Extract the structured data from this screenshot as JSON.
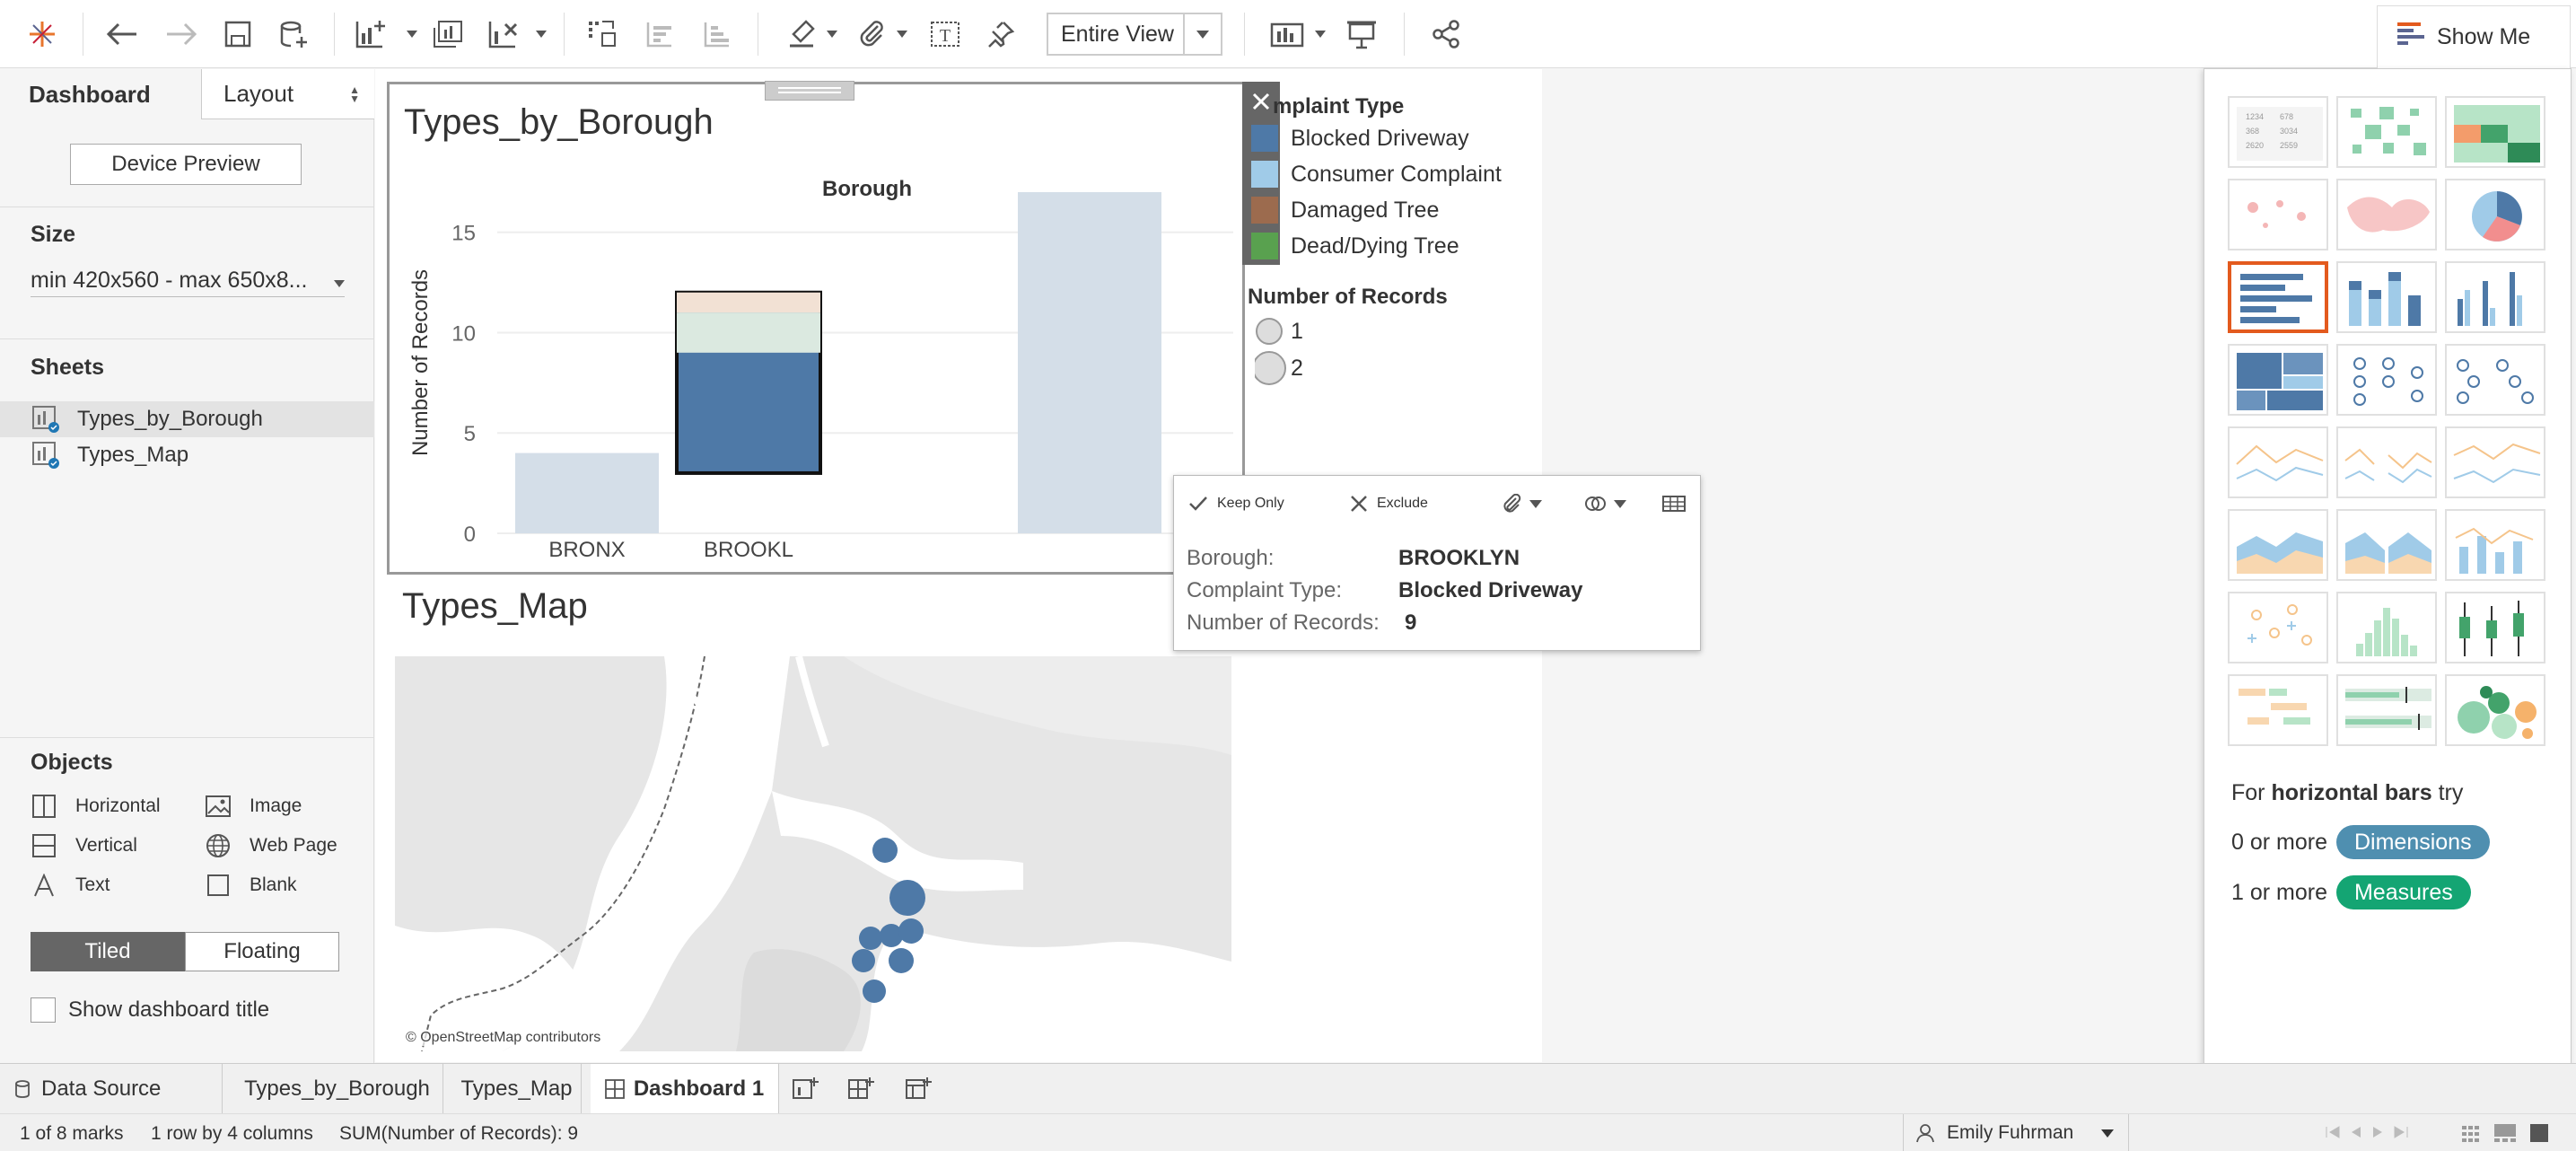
{
  "toolbar": {
    "view_select": "Entire View",
    "show_me_label": "Show Me"
  },
  "left_panel": {
    "tabs": {
      "dashboard": "Dashboard",
      "layout": "Layout"
    },
    "device_preview": "Device Preview",
    "size": {
      "heading": "Size",
      "value": "min 420x560 - max 650x8..."
    },
    "sheets": {
      "heading": "Sheets",
      "items": [
        "Types_by_Borough",
        "Types_Map"
      ]
    },
    "objects": {
      "heading": "Objects",
      "items": [
        "Horizontal",
        "Image",
        "Vertical",
        "Web Page",
        "Text",
        "Blank"
      ]
    },
    "tiled": "Tiled",
    "floating": "Floating",
    "show_title": "Show dashboard title"
  },
  "dashboard": {
    "sheet1_title": "Types_by_Borough",
    "sheet2_title": "Types_Map",
    "legend": {
      "title": "mplaint Type",
      "items": [
        {
          "label": "Blocked Driveway",
          "color": "#4e79a7"
        },
        {
          "label": "Consumer Complaint",
          "color": "#a0cbe8"
        },
        {
          "label": "Damaged Tree",
          "color": "#9c6b4e"
        },
        {
          "label": "Dead/Dying Tree",
          "color": "#59a14f"
        }
      ],
      "size_title": "Number of Records",
      "size_items": [
        "1",
        "2"
      ]
    },
    "tooltip": {
      "keep_only": "Keep Only",
      "exclude": "Exclude",
      "rows": [
        {
          "label": "Borough:",
          "value": "BROOKLYN"
        },
        {
          "label": "Complaint Type:",
          "value": "Blocked Driveway"
        },
        {
          "label": "Number of Records:",
          "value": "9"
        }
      ]
    },
    "map_attribution": "© OpenStreetMap contributors"
  },
  "chart_data": {
    "type": "bar",
    "title": "Types_by_Borough",
    "column_header": "Borough",
    "ylabel": "Number of Records",
    "ylim": [
      0,
      17
    ],
    "yticks": [
      0,
      5,
      10,
      15
    ],
    "categories": [
      "BRONX",
      "BROOKL",
      "",
      ""
    ],
    "series": [
      {
        "name": "Blocked Driveway",
        "values": [
          4,
          9,
          0,
          17
        ]
      },
      {
        "name": "Consumer Complaint",
        "values": [
          0,
          2,
          0,
          0
        ]
      },
      {
        "name": "Damaged Tree",
        "values": [
          0,
          1,
          0,
          0
        ]
      }
    ],
    "highlighted": {
      "category": "BROOKL",
      "value": 12
    },
    "grid": true
  },
  "show_me": {
    "hint_prefix": "For ",
    "hint_bold": "horizontal bars",
    "hint_suffix": " try",
    "req1_prefix": "0 or more",
    "req1_pill": "Dimensions",
    "req2_prefix": "1 or more",
    "req2_pill": "Measures"
  },
  "sheet_tabs": [
    "Data Source",
    "Types_by_Borough",
    "Types_Map",
    "Dashboard 1"
  ],
  "status": {
    "marks": "1 of 8 marks",
    "rows": "1 row by 4 columns",
    "sum": "SUM(Number of Records): 9",
    "user": "Emily Fuhrman"
  }
}
